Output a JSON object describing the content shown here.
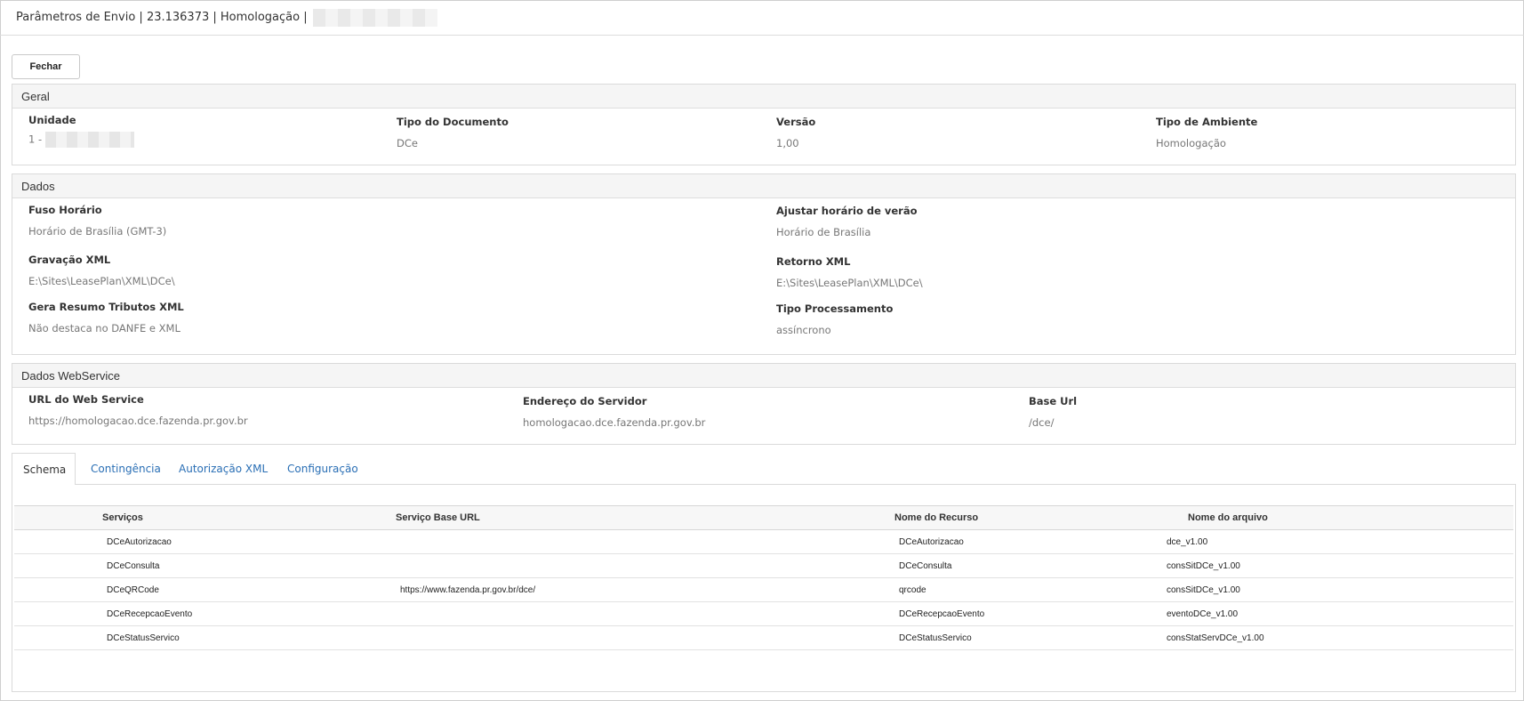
{
  "header": {
    "title": "Parâmetros de Envio | 23.136373 | Homologação |"
  },
  "toolbar": {
    "close_label": "Fechar"
  },
  "geral": {
    "title": "Geral",
    "unidade_label": "Unidade",
    "unidade_value": "1 -",
    "tipo_documento_label": "Tipo do Documento",
    "tipo_documento_value": "DCe",
    "versao_label": "Versão",
    "versao_value": "1,00",
    "tipo_ambiente_label": "Tipo de Ambiente",
    "tipo_ambiente_value": "Homologação"
  },
  "dados": {
    "title": "Dados",
    "fuso_label": "Fuso Horário",
    "fuso_value": "Horário de Brasília (GMT-3)",
    "ajustar_label": "Ajustar horário de verão",
    "ajustar_value": "Horário de Brasília",
    "gravacao_label": "Gravação XML",
    "gravacao_value": "E:\\Sites\\LeasePlan\\XML\\DCe\\",
    "retorno_label": "Retorno XML",
    "retorno_value": "E:\\Sites\\LeasePlan\\XML\\DCe\\",
    "gera_resumo_label": "Gera Resumo Tributos XML",
    "gera_resumo_value": "Não destaca no DANFE e XML",
    "tipo_proc_label": "Tipo Processamento",
    "tipo_proc_value": "assíncrono"
  },
  "webservice": {
    "title": "Dados WebService",
    "url_label": "URL do Web Service",
    "url_value": "https://homologacao.dce.fazenda.pr.gov.br",
    "endereco_label": "Endereço do Servidor",
    "endereco_value": "homologacao.dce.fazenda.pr.gov.br",
    "base_label": "Base Url",
    "base_value": "/dce/"
  },
  "tabs": [
    {
      "label": "Schema"
    },
    {
      "label": "Contingência"
    },
    {
      "label": "Autorização XML"
    },
    {
      "label": "Configuração"
    }
  ],
  "grid": {
    "columns": [
      "Serviços",
      "Serviço Base URL",
      "Nome do Recurso",
      "Nome do arquivo"
    ],
    "rows": [
      {
        "servico": "DCeAutorizacao",
        "base_url": "",
        "recurso": "DCeAutorizacao",
        "arquivo": "dce_v1.00"
      },
      {
        "servico": "DCeConsulta",
        "base_url": "",
        "recurso": "DCeConsulta",
        "arquivo": "consSitDCe_v1.00"
      },
      {
        "servico": "DCeQRCode",
        "base_url": "https://www.fazenda.pr.gov.br/dce/",
        "recurso": "qrcode",
        "arquivo": "consSitDCe_v1.00"
      },
      {
        "servico": "DCeRecepcaoEvento",
        "base_url": "",
        "recurso": "DCeRecepcaoEvento",
        "arquivo": "eventoDCe_v1.00"
      },
      {
        "servico": "DCeStatusServico",
        "base_url": "",
        "recurso": "DCeStatusServico",
        "arquivo": "consStatServDCe_v1.00"
      }
    ]
  }
}
